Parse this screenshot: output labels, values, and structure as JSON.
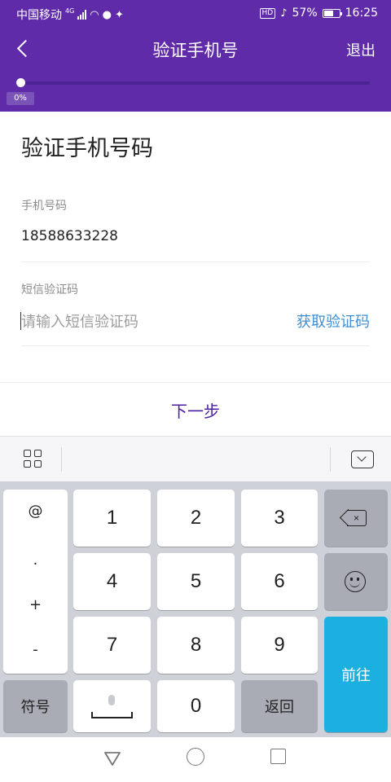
{
  "status_bar": {
    "carrier": "中国移动",
    "network": "4G",
    "battery": "57%",
    "time": "16:25",
    "hd_badge": "HD"
  },
  "header": {
    "title": "验证手机号",
    "exit_label": "退出",
    "progress_percent_label": "0%",
    "progress_fraction": 0
  },
  "form": {
    "heading": "验证手机号码",
    "phone_label": "手机号码",
    "phone_value": "18588633228",
    "sms_label": "短信验证码",
    "sms_placeholder": "请输入短信验证码",
    "get_code_label": "获取验证码",
    "next_label": "下一步"
  },
  "keyboard": {
    "symbols": [
      "@",
      ".",
      "+",
      "-"
    ],
    "digits": [
      "1",
      "2",
      "3",
      "4",
      "5",
      "6",
      "7",
      "8",
      "9",
      "0"
    ],
    "symbols_key": "符号",
    "return_key": "返回",
    "go_key": "前往"
  },
  "colors": {
    "header_bg": "#5f2ba8",
    "link": "#3f8fd6",
    "next": "#4a1fa0",
    "go_key": "#1cb0e0"
  }
}
